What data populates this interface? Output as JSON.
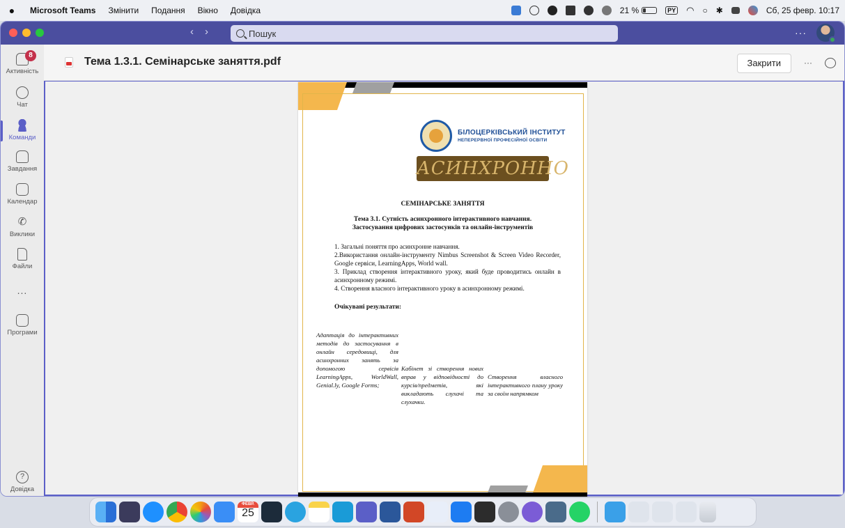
{
  "menubar": {
    "app_name": "Microsoft Teams",
    "menus": [
      "Змінити",
      "Подання",
      "Вікно",
      "Довідка"
    ],
    "battery": "21 %",
    "input_lang": "PY",
    "datetime": "Сб, 25 февр.  10:17"
  },
  "titlebar": {
    "search_placeholder": "Пошук",
    "more": "···"
  },
  "rail": {
    "items": [
      {
        "label": "Активність",
        "icon": "bell-icon",
        "badge": "8"
      },
      {
        "label": "Чат",
        "icon": "chat-icon"
      },
      {
        "label": "Команди",
        "icon": "teams-icon",
        "active": true
      },
      {
        "label": "Завдання",
        "icon": "backpack-icon"
      },
      {
        "label": "Календар",
        "icon": "calendar-icon"
      },
      {
        "label": "Виклики",
        "icon": "phone-icon"
      },
      {
        "label": "Файли",
        "icon": "file-icon"
      },
      {
        "label": "...",
        "icon": "more-icon"
      },
      {
        "label": "Програми",
        "icon": "apps-icon"
      },
      {
        "label": "Довідка",
        "icon": "help-icon"
      }
    ]
  },
  "header": {
    "file_title": "Тема 1.3.1. Семінарське заняття.pdf",
    "close_label": "Закрити",
    "more": "···"
  },
  "document": {
    "institute_line1": "БІЛОЦЕРКІВСЬКИЙ ІНСТИТУТ",
    "institute_line2": "НЕПЕРЕРВНОЇ ПРОФЕСІЙНОЇ ОСВІТИ",
    "banner": "АСИНХРОННО",
    "heading": "СЕМІНАРСЬКЕ ЗАНЯТТЯ",
    "topic_line1": "Тема 3.1. Сутність асинхронного інтерактивного навчання.",
    "topic_line2": "Застосування цифрових застосунків та онлайн-інструментів",
    "list": [
      "1. Загальні поняття про асинхронне навчання.",
      "2.Використання онлайн-інструменту Nimbus Screenshot & Screen Video Recorder, Google сервіси, LearningApps, World wall.",
      "3. Приклад створення інтерактивного уроку, який буде проводитись онлайн в асинхронному режимі.",
      "4. Створення власного інтерактивного уроку в асинхронному режимі."
    ],
    "results_heading": "Очікувані результати:",
    "col1": "Адаптація до інтерактивних методів до застосування в онлайн середовищі, для асинхронних занять за допомогою сервісів LearningApps, WorldWall, Genial.ly, Google Forms;",
    "col2": "Кабінет зі створення нових вправ у відповідності до курсів/предметів, які викладають слухачі та слухачки.",
    "col3": "Створення власного інтерактивного плану уроку за своїм напрямком"
  },
  "dock": {
    "calendar_month": "ФЕВР.",
    "calendar_day": "25"
  }
}
